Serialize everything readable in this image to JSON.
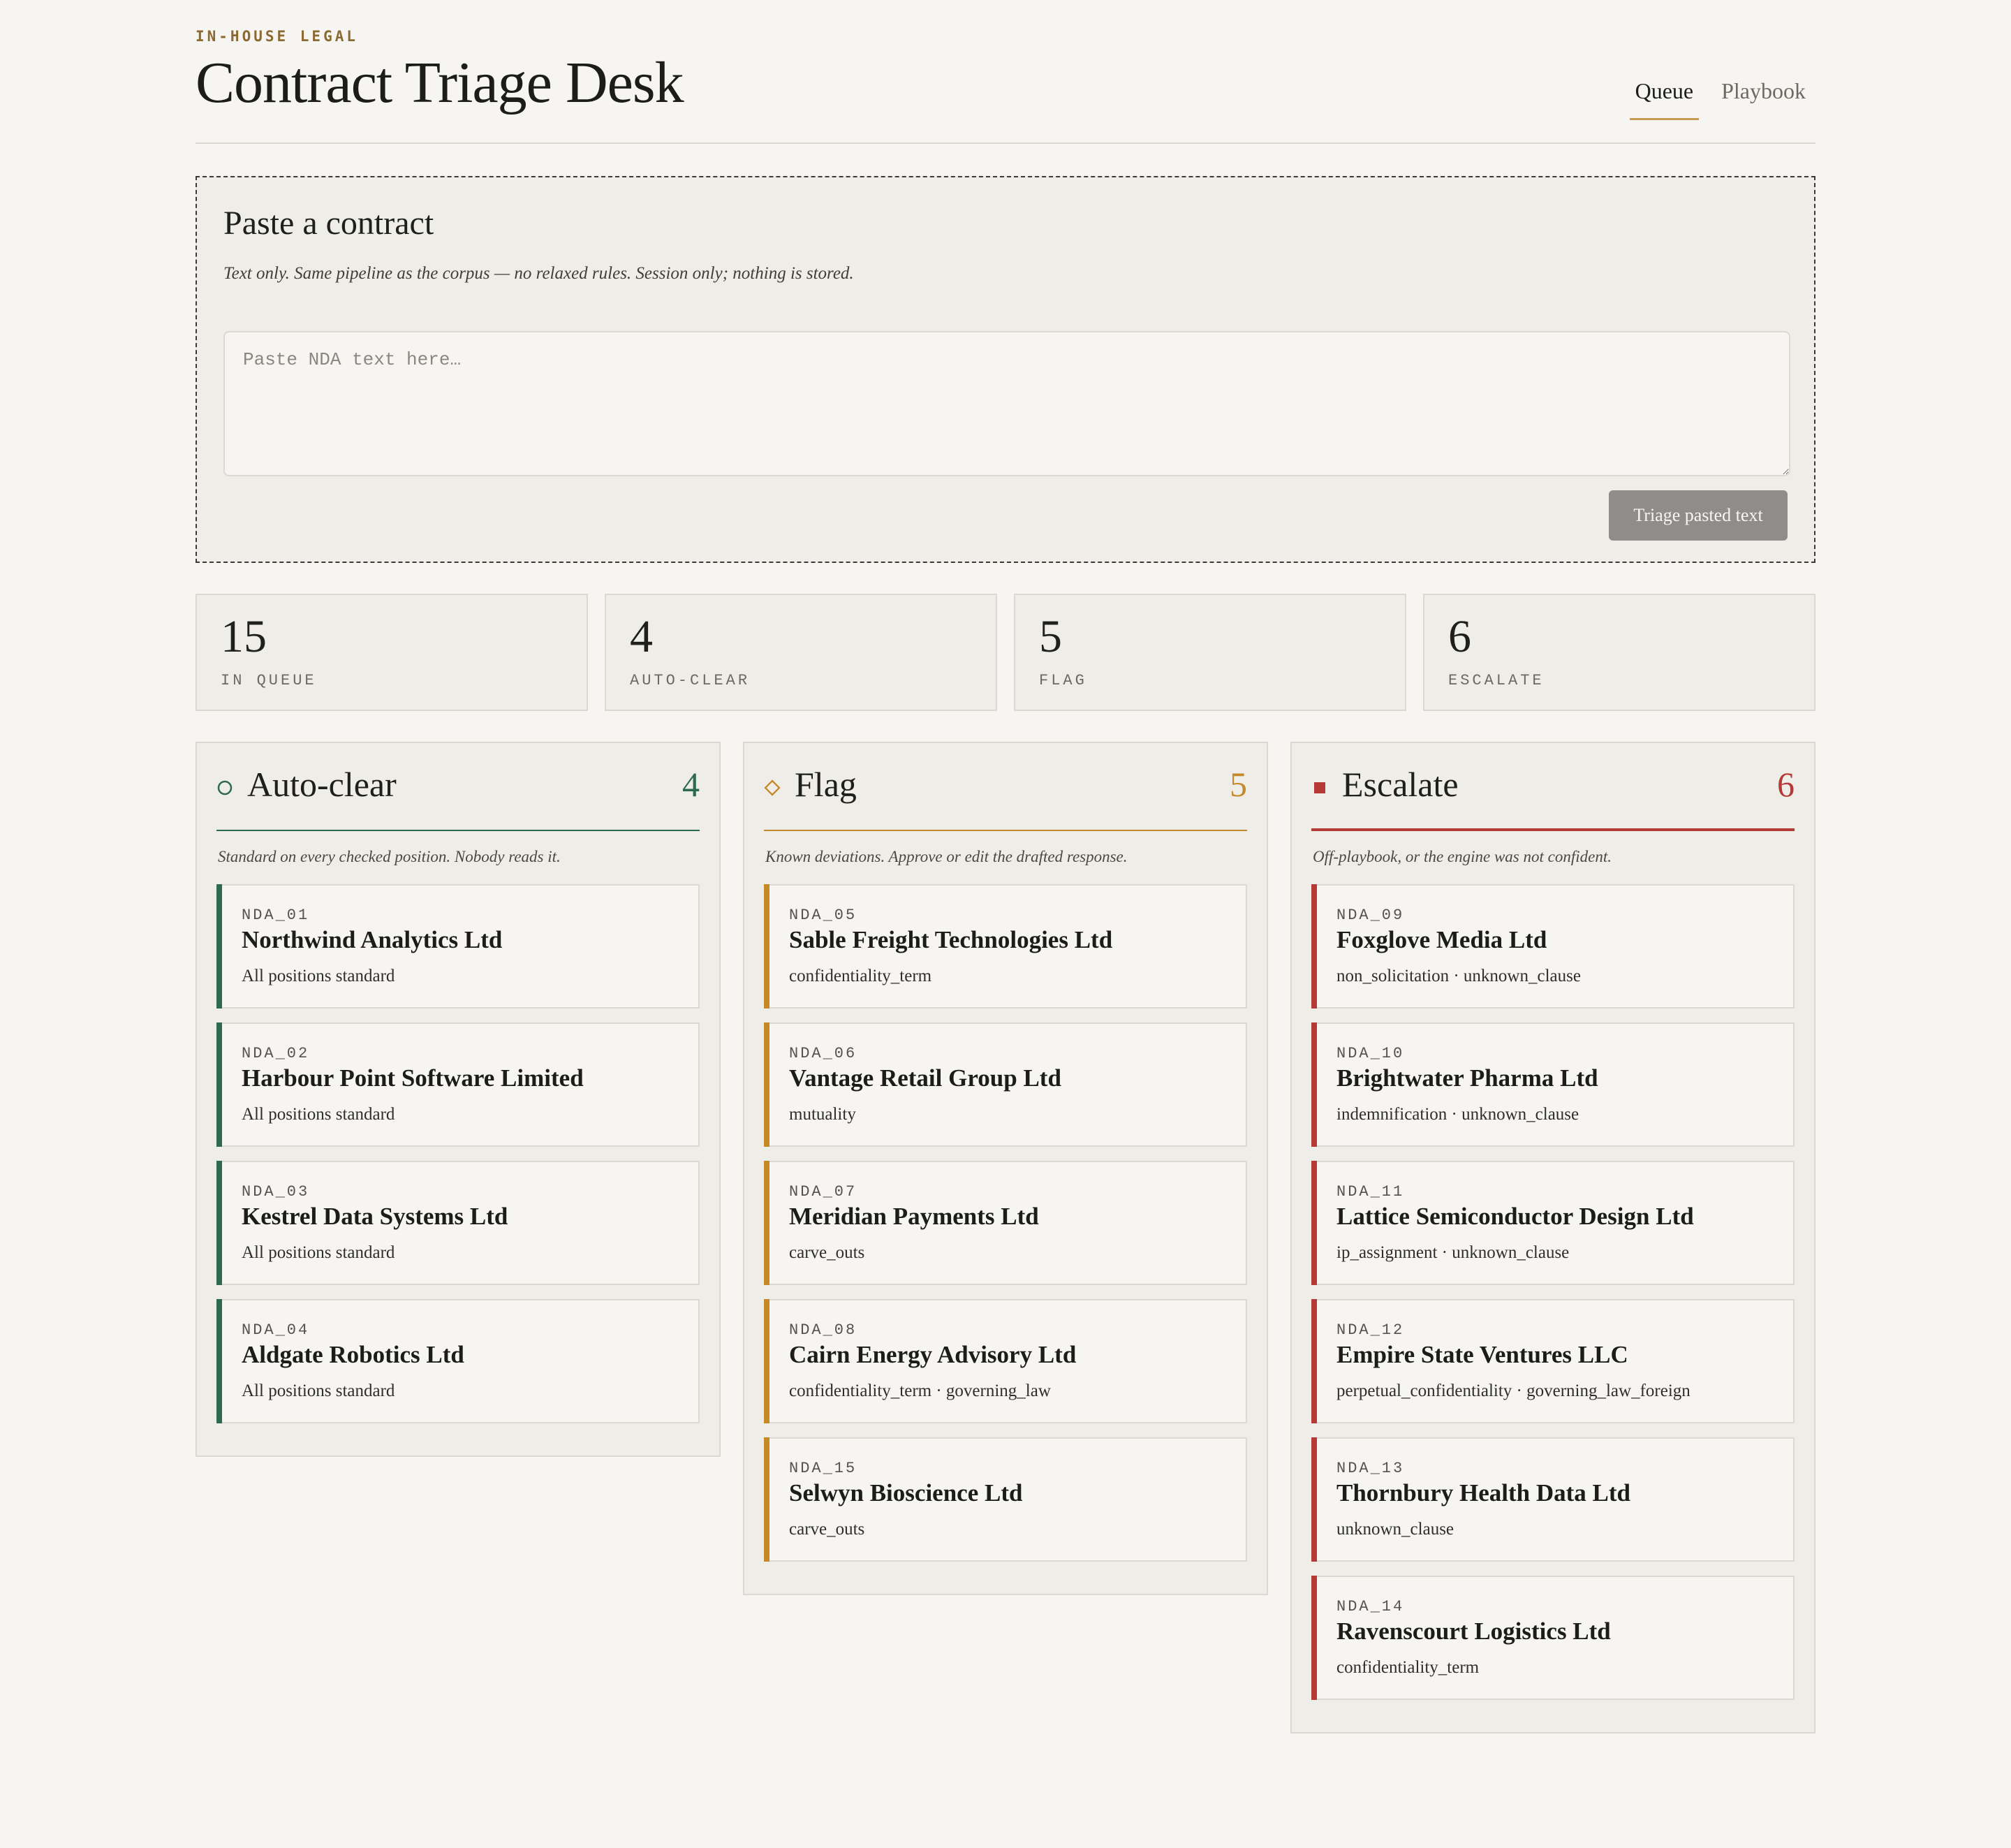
{
  "colors": {
    "auto_clear": "#2e6b4d",
    "flag": "#c6892a",
    "escalate": "#b53a37",
    "eyebrow": "#8a6a32",
    "tab_underline": "#c49a54"
  },
  "header": {
    "eyebrow": "IN-HOUSE LEGAL",
    "title": "Contract Triage Desk",
    "tabs": [
      {
        "label": "Queue",
        "active": true
      },
      {
        "label": "Playbook",
        "active": false
      }
    ]
  },
  "paste": {
    "heading": "Paste a contract",
    "subtitle": "Text only. Same pipeline as the corpus — no relaxed rules. Session only; nothing is stored.",
    "placeholder": "Paste NDA text here…",
    "value": "",
    "button_label": "Triage pasted text"
  },
  "stats": [
    {
      "value": "15",
      "label": "IN QUEUE"
    },
    {
      "value": "4",
      "label": "AUTO-CLEAR"
    },
    {
      "value": "5",
      "label": "FLAG"
    },
    {
      "value": "6",
      "label": "ESCALATE"
    }
  ],
  "columns": [
    {
      "icon": "circle-outline-icon",
      "title": "Auto-clear",
      "count": "4",
      "description": "Standard on every checked position. Nobody reads it.",
      "cards": [
        {
          "id": "NDA_01",
          "name": "Northwind Analytics Ltd",
          "tags": "All positions standard"
        },
        {
          "id": "NDA_02",
          "name": "Harbour Point Software Limited",
          "tags": "All positions standard"
        },
        {
          "id": "NDA_03",
          "name": "Kestrel Data Systems Ltd",
          "tags": "All positions standard"
        },
        {
          "id": "NDA_04",
          "name": "Aldgate Robotics Ltd",
          "tags": "All positions standard"
        }
      ]
    },
    {
      "icon": "diamond-outline-icon",
      "title": "Flag",
      "count": "5",
      "description": "Known deviations. Approve or edit the drafted response.",
      "cards": [
        {
          "id": "NDA_05",
          "name": "Sable Freight Technologies Ltd",
          "tags": "confidentiality_term"
        },
        {
          "id": "NDA_06",
          "name": "Vantage Retail Group Ltd",
          "tags": "mutuality"
        },
        {
          "id": "NDA_07",
          "name": "Meridian Payments Ltd",
          "tags": "carve_outs"
        },
        {
          "id": "NDA_08",
          "name": "Cairn Energy Advisory Ltd",
          "tags": "confidentiality_term · governing_law"
        },
        {
          "id": "NDA_15",
          "name": "Selwyn Bioscience Ltd",
          "tags": "carve_outs"
        }
      ]
    },
    {
      "icon": "filled-square-icon",
      "title": "Escalate",
      "count": "6",
      "description": "Off-playbook, or the engine was not confident.",
      "cards": [
        {
          "id": "NDA_09",
          "name": "Foxglove Media Ltd",
          "tags": "non_solicitation · unknown_clause"
        },
        {
          "id": "NDA_10",
          "name": "Brightwater Pharma Ltd",
          "tags": "indemnification · unknown_clause"
        },
        {
          "id": "NDA_11",
          "name": "Lattice Semiconductor Design Ltd",
          "tags": "ip_assignment · unknown_clause"
        },
        {
          "id": "NDA_12",
          "name": "Empire State Ventures LLC",
          "tags": "perpetual_confidentiality · governing_law_foreign"
        },
        {
          "id": "NDA_13",
          "name": "Thornbury Health Data Ltd",
          "tags": "unknown_clause"
        },
        {
          "id": "NDA_14",
          "name": "Ravenscourt Logistics Ltd",
          "tags": "confidentiality_term"
        }
      ]
    }
  ]
}
